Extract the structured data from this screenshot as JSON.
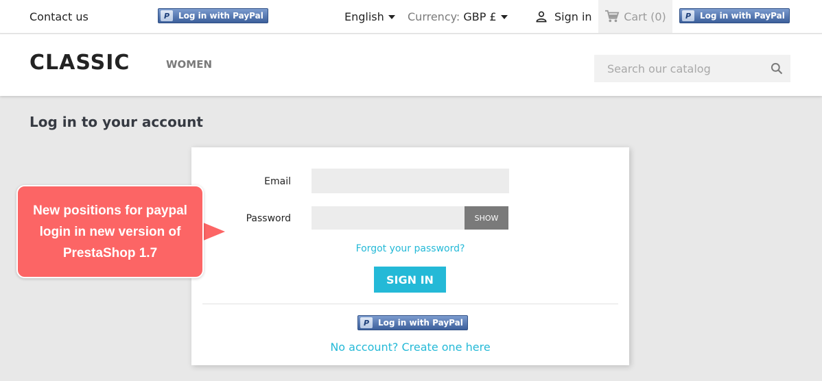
{
  "topbar": {
    "contact_label": "Contact us",
    "paypal_label": "Log in with PayPal",
    "paypal_logo": "P",
    "language": "English",
    "currency_label": "Currency:",
    "currency_value": "GBP £",
    "signin_label": "Sign in",
    "cart_label": "Cart (0)"
  },
  "header": {
    "logo": "CLASSIC",
    "menu_women": "WOMEN",
    "search_placeholder": "Search our catalog"
  },
  "login": {
    "title": "Log in to your account",
    "email_label": "Email",
    "password_label": "Password",
    "show_label": "SHOW",
    "forgot_label": "Forgot your password?",
    "signin_button": "SIGN IN",
    "paypal_label": "Log in with PayPal",
    "paypal_logo": "P",
    "create_account": "No account? Create one here"
  },
  "callout": {
    "text": "New positions for paypal login in new version of PrestaShop 1.7"
  },
  "colors": {
    "accent": "#24b9d7",
    "callout": "#fc6565",
    "paypal": "#3c5f9b"
  },
  "icons": [
    "user-icon",
    "cart-icon",
    "search-icon",
    "paypal-icon",
    "caret-down-icon"
  ]
}
